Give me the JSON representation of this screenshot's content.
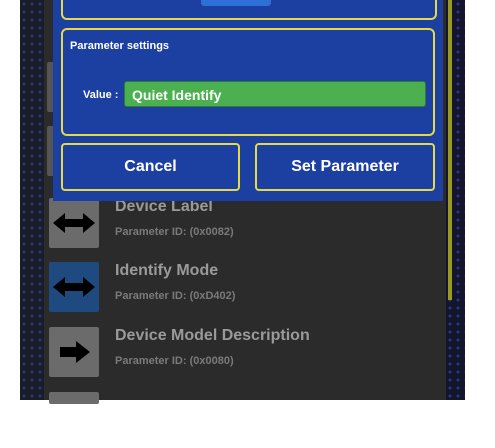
{
  "dialog": {
    "section_title": "Parameter settings",
    "value_label": "Value :",
    "value": "Quiet Identify",
    "cancel_label": "Cancel",
    "set_label": "Set Parameter"
  },
  "list": {
    "items": [
      {
        "title": "Device Label",
        "subtitle": "Parameter ID: (0x0082)",
        "icon": "swap-horizontal-icon"
      },
      {
        "title": "Identify Mode",
        "subtitle": "Parameter ID: (0xD402)",
        "icon": "swap-horizontal-icon"
      },
      {
        "title": "Device Model Description",
        "subtitle": "Parameter ID: (0x0080)",
        "icon": "arrow-right-icon"
      }
    ]
  }
}
